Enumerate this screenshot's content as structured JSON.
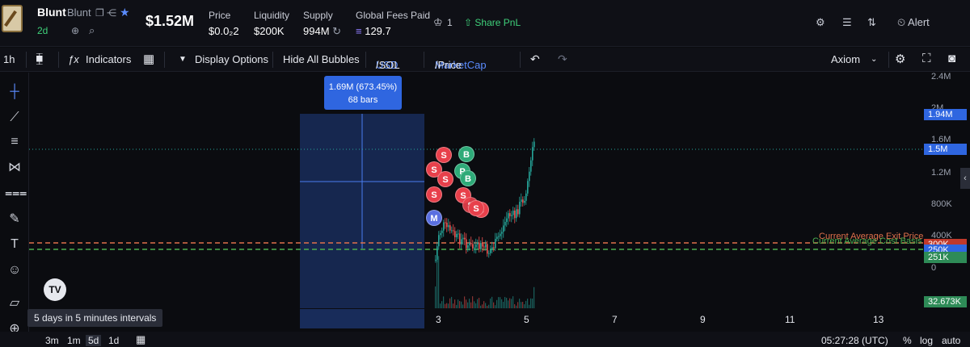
{
  "header": {
    "token_name": "Blunt",
    "token_ticker": "Blunt",
    "age": "2d",
    "market_cap": "$1.52M",
    "stats": [
      {
        "label": "Price",
        "value": "$0.0₂2"
      },
      {
        "label": "Liquidity",
        "value": "$200K"
      },
      {
        "label": "Supply",
        "value": "994M"
      },
      {
        "label": "Global Fees Paid",
        "value": "129.7"
      }
    ],
    "holders_count": "1",
    "share_label": "Share PnL",
    "alert_label": "Alert"
  },
  "toolbar": {
    "interval": "1h",
    "indicators_label": "Indicators",
    "display_options_label": "Display Options",
    "hide_bubbles_label": "Hide All Bubbles",
    "usd_label": "USD",
    "sol_label": "/SOL",
    "marketcap_label": "MarketCap",
    "price_label": "/Price",
    "source_label": "Axiom"
  },
  "chart": {
    "measure_line1": "1.69M (673.45%)",
    "measure_line2": "68 bars",
    "y_labels": [
      "2.4M",
      "2M",
      "1.6M",
      "1.2M",
      "800K",
      "400K",
      "0"
    ],
    "y_tags": [
      {
        "label": "1.94M",
        "color": "#2f66e0"
      },
      {
        "label": "1.5M",
        "color": "#2f66e0"
      },
      {
        "label": "300K",
        "color": "#c0392b"
      },
      {
        "label": "250K",
        "color": "#2f66e0"
      },
      {
        "label": "251K",
        "color": "#2e8b57"
      },
      {
        "label": "32.673K",
        "color": "#2e8b57"
      }
    ],
    "exit_label": "Current Average Exit Price",
    "cost_label": "Current Average Cost Basis",
    "x_labels": [
      "3",
      "5",
      "7",
      "9",
      "11",
      "13"
    ],
    "bubbles": [
      "S",
      "B",
      "S",
      "P",
      "S",
      "B",
      "S",
      "S",
      "S",
      "M"
    ],
    "colors": {
      "up": "#26a69a",
      "down": "#ef5350",
      "exit": "#e0704b",
      "cost": "#4caf50"
    }
  },
  "footer": {
    "tooltip": "5 days in 5 minutes intervals",
    "ranges": [
      "3m",
      "1m",
      "5d",
      "1d"
    ],
    "time": "05:27:28 (UTC)",
    "percent": "%",
    "log": "log",
    "auto": "auto"
  }
}
